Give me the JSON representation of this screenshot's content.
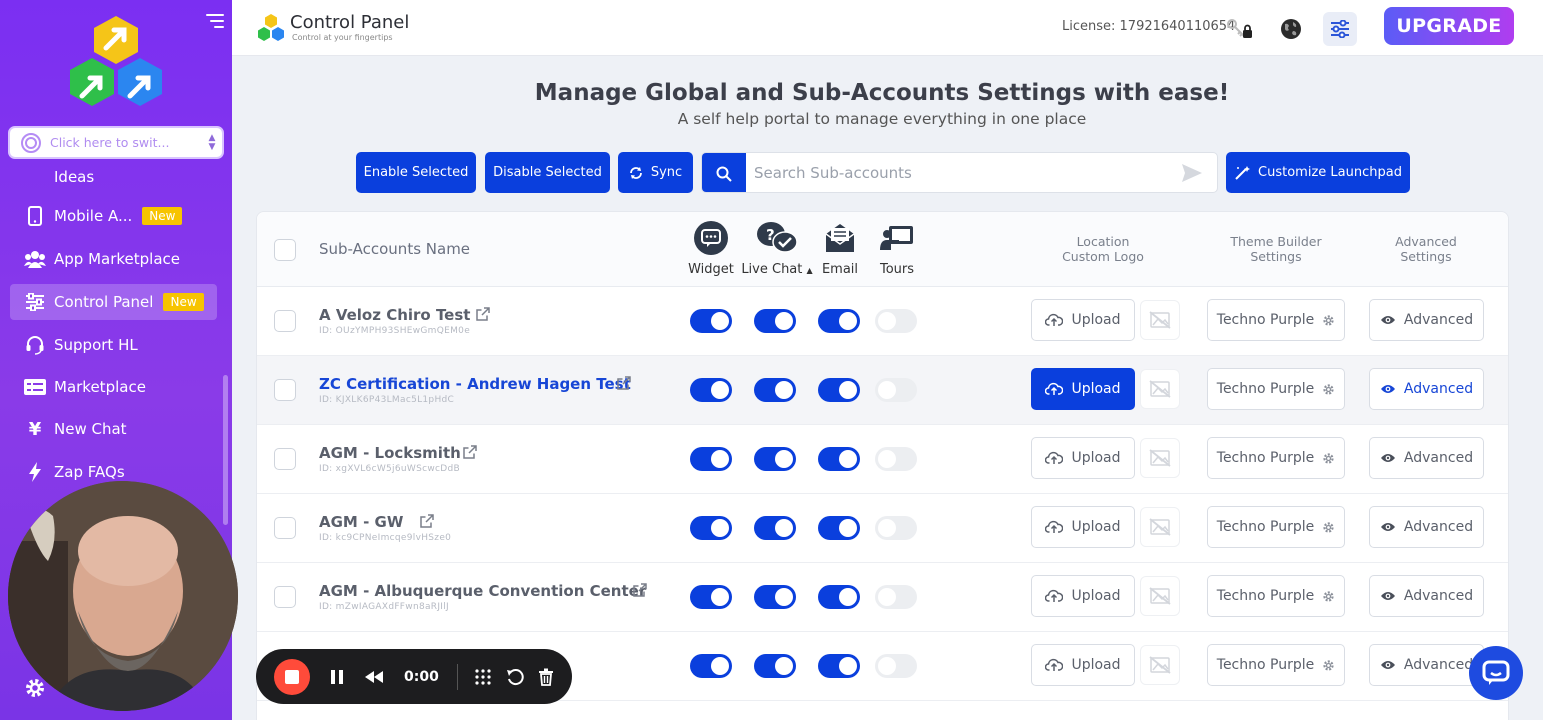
{
  "sidebar": {
    "switcher_placeholder": "Click here to swit...",
    "partial_item": "Ideas",
    "items": [
      {
        "label": "Mobile A...",
        "badge": "New"
      },
      {
        "label": "App Marketplace",
        "badge": ""
      },
      {
        "label": "Control Panel",
        "badge": "New"
      },
      {
        "label": "Support HL",
        "badge": ""
      },
      {
        "label": "Marketplace",
        "badge": ""
      },
      {
        "label": "New Chat",
        "badge": ""
      },
      {
        "label": "Zap FAQs",
        "badge": ""
      }
    ]
  },
  "topbar": {
    "title": "Control Panel",
    "subtitle": "Control at your fingertips",
    "license": "License: 17921640110654",
    "upgrade_label": "UPGRADE"
  },
  "headline": {
    "title": "Manage Global and Sub-Accounts Settings with ease!",
    "subtitle": "A self help portal to manage everything in one place"
  },
  "actions": {
    "enable_label": "Enable Selected",
    "disable_label": "Disable Selected",
    "sync_label": "Sync",
    "search_placeholder": "Search Sub-accounts",
    "customize_label": "Customize Launchpad"
  },
  "table": {
    "headers": {
      "name": "Sub-Accounts Name",
      "widget": "Widget",
      "livechat": "Live Chat",
      "email": "Email",
      "tours": "Tours",
      "location_logo_1": "Location",
      "location_logo_2": "Custom Logo",
      "theme_1": "Theme Builder",
      "theme_2": "Settings",
      "advanced_1": "Advanced",
      "advanced_2": "Settings"
    },
    "upload_label": "Upload",
    "theme_label": "Techno Purple",
    "advanced_label": "Advanced",
    "rows": [
      {
        "name": "A Veloz Chiro Test",
        "id": "ID: OUzYMPH93SHEwGmQEM0e",
        "widget": true,
        "livechat": true,
        "email": true,
        "tours": false
      },
      {
        "name": "ZC Certification - Andrew Hagen Test",
        "id": "ID: KJXLK6P43LMac5L1pHdC",
        "widget": true,
        "livechat": true,
        "email": true,
        "tours": false
      },
      {
        "name": "AGM - Locksmith",
        "id": "ID: xgXVL6cW5j6uWScwcDdB",
        "widget": true,
        "livechat": true,
        "email": true,
        "tours": false
      },
      {
        "name": "AGM - GW",
        "id": "ID: kc9CPNeImcqe9lvHSze0",
        "widget": true,
        "livechat": true,
        "email": true,
        "tours": false
      },
      {
        "name": "AGM - Albuquerque Convention Center",
        "id": "ID: mZwIAGAXdFFwn8aRJIlJ",
        "widget": true,
        "livechat": true,
        "email": true,
        "tours": false
      },
      {
        "name": "",
        "id": "",
        "widget": true,
        "livechat": true,
        "email": true,
        "tours": false
      }
    ]
  },
  "recorder": {
    "time": "0:00"
  },
  "colors": {
    "primary_blue": "#0a3fdd",
    "sidebar_purple": "#7b2ff2",
    "badge_yellow": "#f7c400",
    "record_red": "#ff4b3a"
  }
}
